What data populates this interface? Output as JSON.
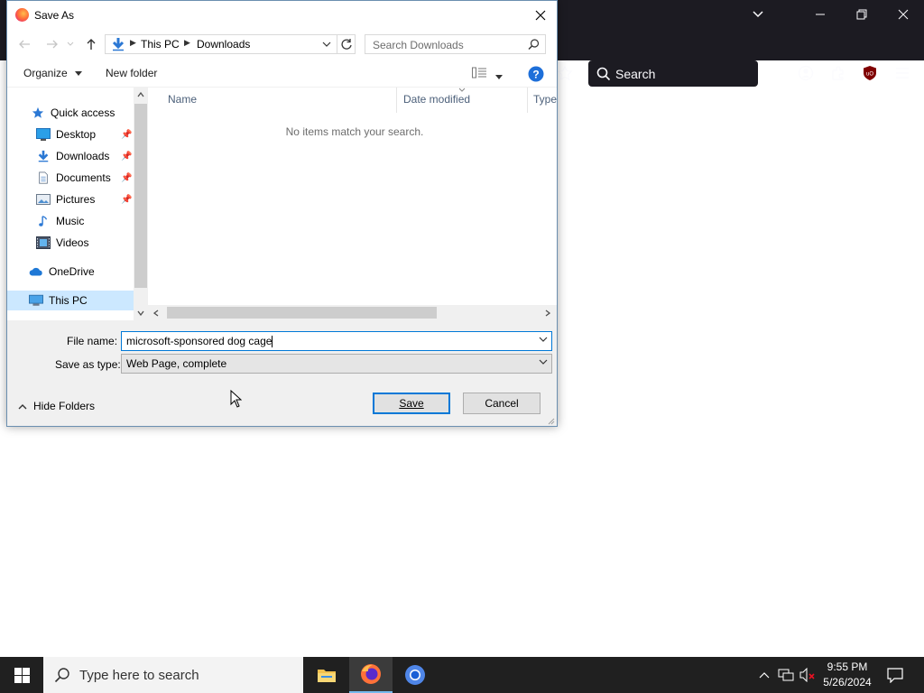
{
  "browser": {
    "search_placeholder": "Search"
  },
  "dialog": {
    "title": "Save As",
    "breadcrumb": [
      "This PC",
      "Downloads"
    ],
    "search_placeholder": "Search Downloads",
    "commands": {
      "organize": "Organize",
      "new_folder": "New folder"
    },
    "sidebar": [
      {
        "label": "Quick access",
        "icon": "star-icon"
      },
      {
        "label": "Desktop",
        "icon": "desktop-icon",
        "pinned": true
      },
      {
        "label": "Downloads",
        "icon": "downloads-icon",
        "pinned": true
      },
      {
        "label": "Documents",
        "icon": "documents-icon",
        "pinned": true
      },
      {
        "label": "Pictures",
        "icon": "pictures-icon",
        "pinned": true
      },
      {
        "label": "Music",
        "icon": "music-icon"
      },
      {
        "label": "Videos",
        "icon": "videos-icon"
      },
      {
        "label": "OneDrive",
        "icon": "cloud-icon"
      },
      {
        "label": "This PC",
        "icon": "computer-icon",
        "selected": true
      }
    ],
    "columns": [
      "Name",
      "Date modified",
      "Type"
    ],
    "empty_message": "No items match your search.",
    "file_name_label": "File name:",
    "file_name_value": "microsoft-sponsored dog cage",
    "save_type_label": "Save as type:",
    "save_type_value": "Web Page, complete",
    "hide_folders": "Hide Folders",
    "save_button": "Save",
    "cancel_button": "Cancel"
  },
  "taskbar": {
    "search_placeholder": "Type here to search",
    "time": "9:55 PM",
    "date": "5/26/2024"
  },
  "colors": {
    "accent": "#0078d7",
    "browser_chrome": "#1c1b22",
    "taskbar": "#202020",
    "selection": "#cce8ff"
  }
}
